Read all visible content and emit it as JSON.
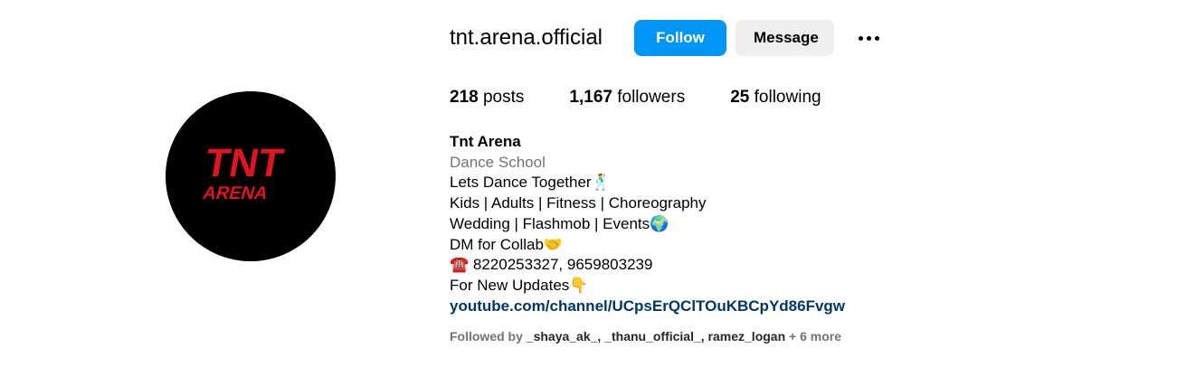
{
  "profile": {
    "username": "tnt.arena.official",
    "follow_label": "Follow",
    "message_label": "Message",
    "avatar_logo_text_top": "TNT",
    "avatar_logo_text_bottom": "ARENA"
  },
  "stats": {
    "posts_count": "218",
    "posts_label": "posts",
    "followers_count": "1,167",
    "followers_label": "followers",
    "following_count": "25",
    "following_label": "following"
  },
  "bio": {
    "name": "Tnt Arena",
    "category": "Dance School",
    "lines": [
      "Lets Dance Together🕺",
      "Kids | Adults | Fitness | Choreography",
      "Wedding | Flashmob | Events🌍",
      "DM for Collab🤝",
      "☎️ 8220253327, 9659803239",
      "For New Updates👇"
    ],
    "link": "youtube.com/channel/UCpsErQClTOuKBCpYd86Fvgw"
  },
  "followed_by": {
    "prefix": "Followed by ",
    "users": "_shaya_ak_, _thanu_official_, ramez_logan",
    "more": " + 6 more"
  },
  "colors": {
    "accent": "#0095f6",
    "link": "#00376b",
    "logo": "#e0141e"
  }
}
